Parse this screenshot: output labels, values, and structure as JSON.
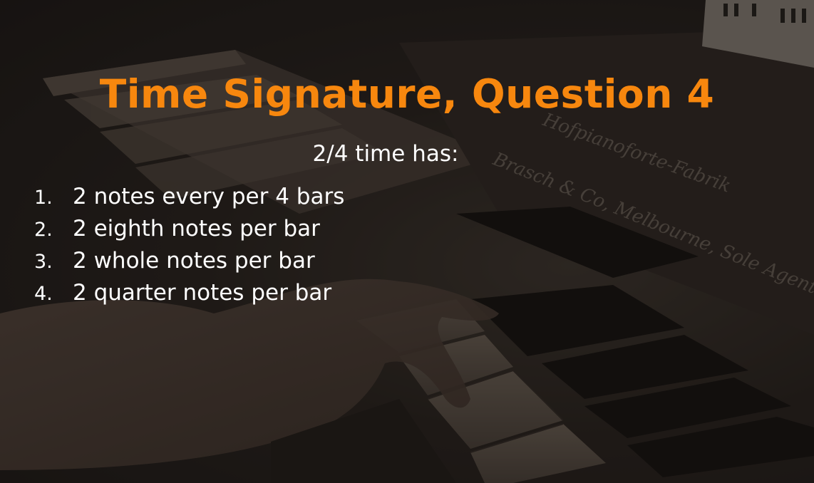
{
  "slide": {
    "title": "Time Signature, Question 4",
    "prompt": "2/4 time has:",
    "options": [
      {
        "number": "1.",
        "text": "2 notes every per 4 bars"
      },
      {
        "number": "2.",
        "text": "2 eighth notes per bar"
      },
      {
        "number": "3.",
        "text": "2 whole notes per bar"
      },
      {
        "number": "4.",
        "text": "2 quarter notes per bar"
      }
    ]
  },
  "background": {
    "subject": "hands playing piano keys",
    "lettering": [
      "Hofpianoforte-Fabrik",
      "Brasch & Co, Melbourne, Sole Agents"
    ]
  },
  "colors": {
    "title": "#f7870e",
    "text": "#ffffff",
    "overlay": "#1b1714"
  }
}
